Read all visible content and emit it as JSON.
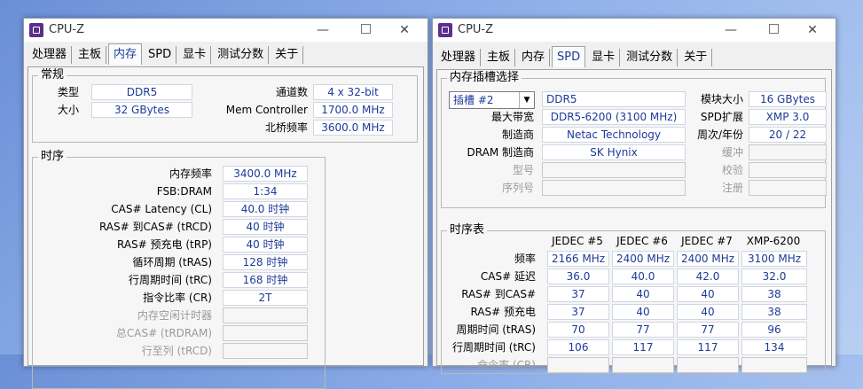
{
  "app_title": "CPU-Z",
  "tabs": [
    "处理器",
    "主板",
    "内存",
    "SPD",
    "显卡",
    "测试分数",
    "关于"
  ],
  "left": {
    "active_tab": 2,
    "general": {
      "title": "常规",
      "type_label": "类型",
      "type_value": "DDR5",
      "size_label": "大小",
      "size_value": "32 GBytes",
      "channels_label": "通道数",
      "channels_value": "4 x 32-bit",
      "memctrl_label": "Mem Controller",
      "memctrl_value": "1700.0 MHz",
      "nb_label": "北桥频率",
      "nb_value": "3600.0 MHz"
    },
    "timings": {
      "title": "时序",
      "rows": [
        {
          "label": "内存频率",
          "value": "3400.0 MHz",
          "dim": false
        },
        {
          "label": "FSB:DRAM",
          "value": "1:34",
          "dim": false
        },
        {
          "label": "CAS# Latency (CL)",
          "value": "40.0 时钟",
          "dim": false
        },
        {
          "label": "RAS# 到CAS# (tRCD)",
          "value": "40 时钟",
          "dim": false
        },
        {
          "label": "RAS# 预充电 (tRP)",
          "value": "40 时钟",
          "dim": false
        },
        {
          "label": "循环周期 (tRAS)",
          "value": "128 时钟",
          "dim": false
        },
        {
          "label": "行周期时间 (tRC)",
          "value": "168 时钟",
          "dim": false
        },
        {
          "label": "指令比率 (CR)",
          "value": "2T",
          "dim": false
        },
        {
          "label": "内存空闲计时器",
          "value": "",
          "dim": true
        },
        {
          "label": "总CAS# (tRDRAM)",
          "value": "",
          "dim": true
        },
        {
          "label": "行至列 (tRCD)",
          "value": "",
          "dim": true
        }
      ]
    }
  },
  "right": {
    "active_tab": 3,
    "slot": {
      "title": "内存插槽选择",
      "slot_value": "插槽 #2",
      "type_value": "DDR5",
      "module_size_label": "模块大小",
      "module_size_value": "16 GBytes",
      "max_bw_label": "最大带宽",
      "max_bw_value": "DDR5-6200 (3100 MHz)",
      "spd_ext_label": "SPD扩展",
      "spd_ext_value": "XMP 3.0",
      "manufacturer_label": "制造商",
      "manufacturer_value": "Netac Technology",
      "week_year_label": "周次/年份",
      "week_year_value": "20 / 22",
      "dram_mfr_label": "DRAM 制造商",
      "dram_mfr_value": "SK Hynix",
      "buffered_label": "缓冲",
      "part_label": "型号",
      "correction_label": "校验",
      "serial_label": "序列号",
      "registered_label": "注册"
    },
    "timing_table": {
      "title": "时序表",
      "columns": [
        "JEDEC #5",
        "JEDEC #6",
        "JEDEC #7",
        "XMP-6200"
      ],
      "rows": [
        {
          "label": "频率",
          "values": [
            "2166 MHz",
            "2400 MHz",
            "2400 MHz",
            "3100 MHz"
          ],
          "dim": false
        },
        {
          "label": "CAS# 延迟",
          "values": [
            "36.0",
            "40.0",
            "42.0",
            "32.0"
          ],
          "dim": false
        },
        {
          "label": "RAS# 到CAS#",
          "values": [
            "37",
            "40",
            "40",
            "38"
          ],
          "dim": false
        },
        {
          "label": "RAS# 预充电",
          "values": [
            "37",
            "40",
            "40",
            "38"
          ],
          "dim": false
        },
        {
          "label": "周期时间 (tRAS)",
          "values": [
            "70",
            "77",
            "77",
            "96"
          ],
          "dim": false
        },
        {
          "label": "行周期时间 (tRC)",
          "values": [
            "106",
            "117",
            "117",
            "134"
          ],
          "dim": false
        },
        {
          "label": "命令率 (CR)",
          "values": [
            "",
            "",
            "",
            ""
          ],
          "dim": true
        }
      ]
    }
  }
}
